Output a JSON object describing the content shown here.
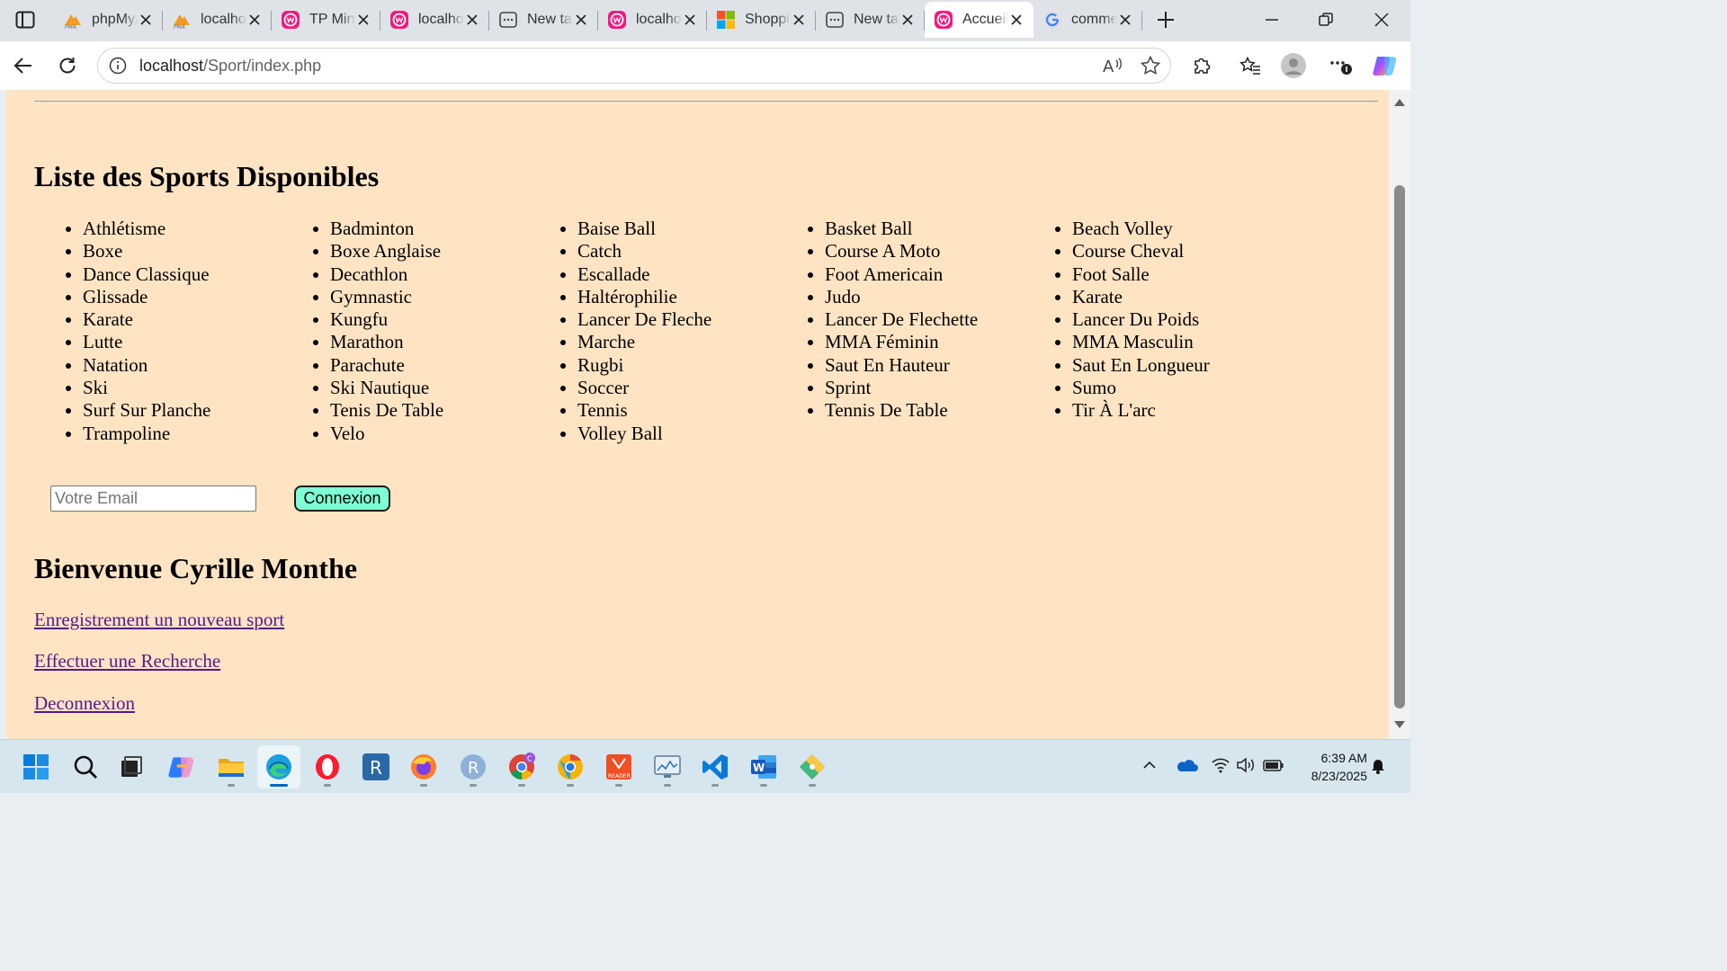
{
  "browser": {
    "tabs": [
      {
        "title": "phpMyAdmin",
        "favicon": "phpmyadmin-icon",
        "active": false
      },
      {
        "title": "localhost",
        "favicon": "phpmyadmin-icon",
        "active": false
      },
      {
        "title": "TP Mini Projet",
        "favicon": "wamp-icon",
        "active": false
      },
      {
        "title": "localhost",
        "favicon": "wamp-icon",
        "active": false
      },
      {
        "title": "New tab",
        "favicon": "newtab-icon",
        "active": false
      },
      {
        "title": "localhost",
        "favicon": "wamp-icon",
        "active": false
      },
      {
        "title": "Shopping",
        "favicon": "shopping-icon",
        "active": false
      },
      {
        "title": "New tab",
        "favicon": "newtab-icon",
        "active": false
      },
      {
        "title": "Accueil",
        "favicon": "wamp-icon",
        "active": true
      },
      {
        "title": "comment",
        "favicon": "google-icon",
        "active": false
      }
    ],
    "url_host": "localhost",
    "url_path": "/Sport/index.php"
  },
  "page": {
    "sports_title": "Liste des Sports Disponibles",
    "sport_columns": [
      [
        "Athlétisme",
        "Boxe",
        "Dance Classique",
        "Glissade",
        "Karate",
        "Lutte",
        "Natation",
        "Ski",
        "Surf Sur Planche",
        "Trampoline"
      ],
      [
        "Badminton",
        "Boxe Anglaise",
        "Decathlon",
        "Gymnastic",
        "Kungfu",
        "Marathon",
        "Parachute",
        "Ski Nautique",
        "Tenis De Table",
        "Velo"
      ],
      [
        "Baise Ball",
        "Catch",
        "Escallade",
        "Haltérophilie",
        "Lancer De Fleche",
        "Marche",
        "Rugbi",
        "Soccer",
        "Tennis",
        "Volley Ball"
      ],
      [
        "Basket Ball",
        "Course A Moto",
        "Foot Americain",
        "Judo",
        "Lancer De Flechette",
        "MMA Féminin",
        "Saut En Hauteur",
        "Sprint",
        "Tennis De Table"
      ],
      [
        "Beach Volley",
        "Course Cheval",
        "Foot Salle",
        "Karate",
        "Lancer Du Poids",
        "MMA Masculin",
        "Saut En Longueur",
        "Sumo",
        "Tir À L'arc"
      ]
    ],
    "email_placeholder": "Votre Email",
    "email_value": "",
    "connexion_label": "Connexion",
    "welcome": "Bienvenue Cyrille Monthe",
    "links": [
      "Enregistrement un nouveau sport",
      "Effectuer une Recherche",
      "Deconnexion"
    ],
    "background_color": "#ffe4c4",
    "button_color": "#7fffd4",
    "link_color": "#551a8b"
  },
  "taskbar": {
    "apps": [
      "windows-start-icon",
      "search-icon",
      "task-view-icon",
      "copilot-icon",
      "file-explorer-icon",
      "edge-icon",
      "opera-icon",
      "rstudio-icon",
      "firefox-icon",
      "r-icon",
      "chrome-icon",
      "chrome-canary-icon",
      "pdf-reader-icon",
      "monitor-icon",
      "vscode-icon",
      "word-icon",
      "git-icon"
    ],
    "time": "6:39 AM",
    "date": "8/23/2025"
  }
}
